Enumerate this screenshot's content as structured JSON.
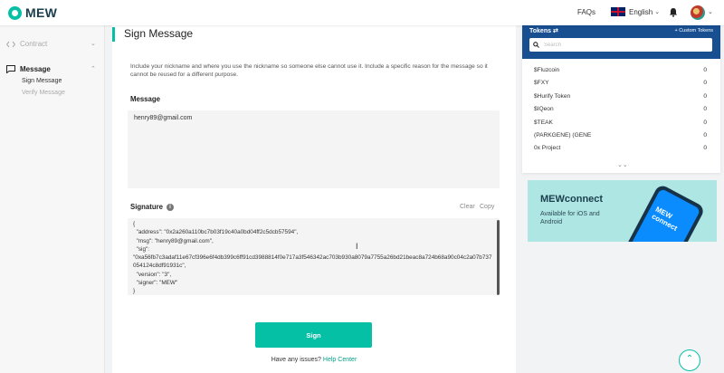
{
  "header": {
    "logo_text": "MEW",
    "faqs": "FAQs",
    "language": "English"
  },
  "sidebar": {
    "contract": "Contract",
    "message": "Message",
    "sign_message": "Sign Message",
    "verify_message": "Verify Message"
  },
  "main": {
    "title": "Sign Message",
    "description": "Include your nickname and where you use the nickname so someone else cannot use it. Include a specific reason for the message so it cannot be reused for a different purpose.",
    "message_label": "Message",
    "message_value": "henry89@gmail.com",
    "signature_label": "Signature",
    "clear_label": "Clear",
    "copy_label": "Copy",
    "signature_value": "{\n  \"address\": \"0x2a260a110bc7b03f19c40a0bd04ff2c5dcb57594\",\n  \"msg\": \"henry89@gmail.com\",\n  \"sig\":\n\"0xa56fb7c3adaf11e67cf396e6f4db399c6ff91cd3988814f0e717a3f546342ac703b930a8079a7755a26bd21beac8a724b68a90c04c2a07b737054124c8df91931c\",\n  \"version\": \"3\",\n  \"signer\": \"MEW\"\n}",
    "sign_button": "Sign",
    "help_prefix": "Have any issues?",
    "help_link": "Help Center"
  },
  "tokens": {
    "title": "Tokens",
    "custom_tokens": "+ Custom Tokens",
    "search_placeholder": "Search",
    "items": [
      {
        "name": "$Fluzcoin",
        "balance": "0"
      },
      {
        "name": "$FXY",
        "balance": "0"
      },
      {
        "name": "$Hurify Token",
        "balance": "0"
      },
      {
        "name": "$IQeon",
        "balance": "0"
      },
      {
        "name": "$TEAK",
        "balance": "0"
      },
      {
        "name": "(PARKGENE) (GENE",
        "balance": "0"
      },
      {
        "name": "0x Project",
        "balance": "0"
      }
    ]
  },
  "banner": {
    "title": "MEWconnect",
    "subtitle": "Available for iOS and Android",
    "phone_text": "MEW connect"
  },
  "colors": {
    "accent": "#05c0a5",
    "tokens_header": "#184f90"
  }
}
